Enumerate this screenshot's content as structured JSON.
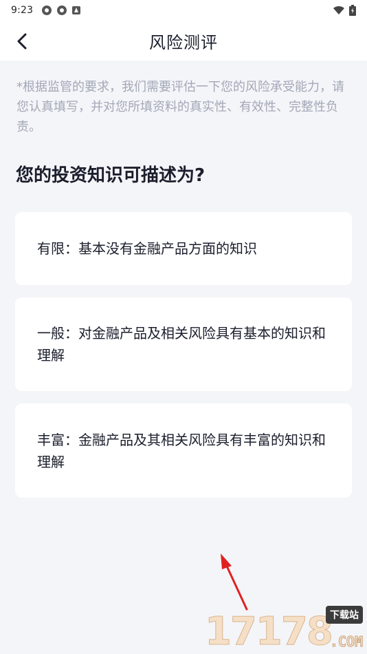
{
  "status_bar": {
    "time": "9:23",
    "left_icons": [
      "settings-icon",
      "settings-icon",
      "app-notification-icon"
    ],
    "right_icons": [
      "wifi-icon",
      "battery-icon"
    ]
  },
  "nav": {
    "title": "风险测评",
    "back_icon": "back-arrow-icon"
  },
  "notice": "*根据监管的要求，我们需要评估一下您的风险承受能力，请您认真填写，并对您所填资料的真实性、有效性、完整性负责。",
  "question": "您的投资知识可描述为?",
  "options": [
    {
      "label": "有限：基本没有金融产品方面的知识"
    },
    {
      "label": "一般：对金融产品及相关风险具有基本的知识和理解"
    },
    {
      "label": "丰富：金融产品及其相关风险具有丰富的知识和理解"
    }
  ],
  "watermark": {
    "digits": "17178",
    "badge": "下载站",
    "suffix": ".COM"
  },
  "colors": {
    "background": "#f4f5f8",
    "card": "#ffffff",
    "text_primary": "#1b1e2c",
    "text_secondary": "#a3a8b8",
    "annotation_arrow": "#e02020"
  }
}
